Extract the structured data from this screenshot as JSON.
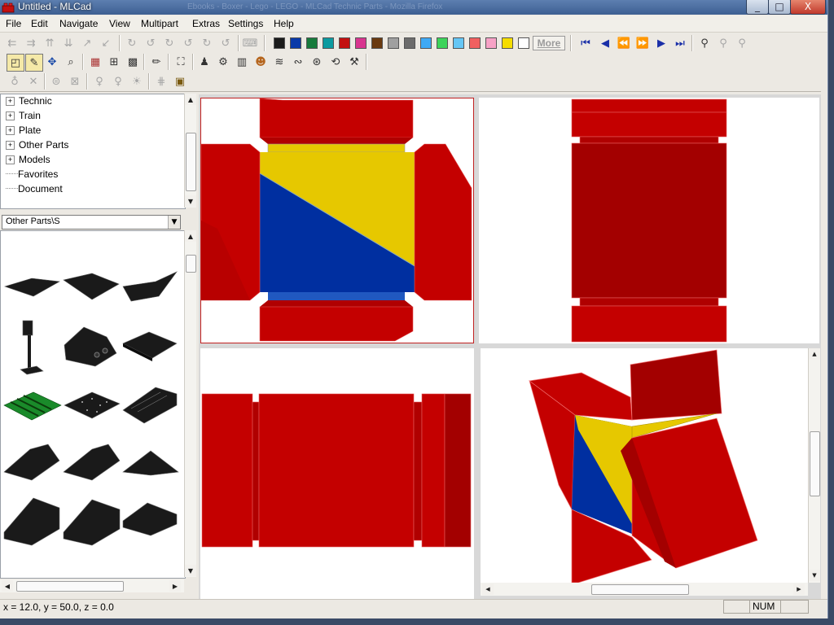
{
  "window": {
    "title": "Untitled - MLCad",
    "background_title": "Ebooks - Boxer - Lego - LEGO - MLCad Technic Parts - Mozilla Firefox",
    "buttons": {
      "minimize": "_",
      "maximize": "□",
      "close": "X"
    }
  },
  "menu": [
    "File",
    "Edit",
    "Navigate",
    "View",
    "Multipart",
    "Extras",
    "Settings",
    "Help"
  ],
  "toolbar_rows": [
    [
      {
        "name": "move-left-icon",
        "glyph": "⇇",
        "enabled": false
      },
      {
        "name": "move-right-icon",
        "glyph": "⇉",
        "enabled": false
      },
      {
        "name": "move-up-icon",
        "glyph": "⇈",
        "enabled": false
      },
      {
        "name": "move-down-icon",
        "glyph": "⇊",
        "enabled": false
      },
      {
        "name": "move-in-icon",
        "glyph": "↗",
        "enabled": false
      },
      {
        "name": "move-out-icon",
        "glyph": "↙",
        "enabled": false
      },
      {
        "name": "rotate-x-plus-icon",
        "glyph": "↻",
        "enabled": false
      },
      {
        "name": "rotate-x-minus-icon",
        "glyph": "↺",
        "enabled": false
      },
      {
        "name": "rotate-y-plus-icon",
        "glyph": "↻",
        "enabled": false
      },
      {
        "name": "rotate-y-minus-icon",
        "glyph": "↺",
        "enabled": false
      },
      {
        "name": "rotate-z-plus-icon",
        "glyph": "↻",
        "enabled": false
      },
      {
        "name": "rotate-z-minus-icon",
        "glyph": "↺",
        "enabled": false
      },
      {
        "name": "keyboard-icon",
        "glyph": "⌨",
        "enabled": false
      }
    ],
    [
      {
        "name": "select-icon",
        "glyph": "◰",
        "enabled": true
      },
      {
        "name": "edit-icon",
        "glyph": "✎",
        "enabled": true
      },
      {
        "name": "move-icon",
        "glyph": "✥",
        "enabled": true
      },
      {
        "name": "zoom-icon",
        "glyph": "⌕",
        "enabled": true
      },
      {
        "name": "view-layout-icon",
        "glyph": "▦",
        "enabled": true
      },
      {
        "name": "grid-icon",
        "glyph": "⊞",
        "enabled": true
      },
      {
        "name": "render-icon",
        "glyph": "▩",
        "enabled": true
      },
      {
        "name": "color-pencil-icon",
        "glyph": "✏",
        "enabled": true
      },
      {
        "name": "part-properties-icon",
        "glyph": "⛶",
        "enabled": true
      },
      {
        "name": "minifig-stand-icon",
        "glyph": "♟",
        "enabled": true
      },
      {
        "name": "gear-part-icon",
        "glyph": "⚙",
        "enabled": true
      },
      {
        "name": "minifig-head-icon",
        "glyph": "☻",
        "enabled": true
      },
      {
        "name": "spring-icon",
        "glyph": "≋",
        "enabled": true
      },
      {
        "name": "hose-icon",
        "glyph": "∾",
        "enabled": true
      },
      {
        "name": "wheel-icon",
        "glyph": "⊛",
        "enabled": true
      },
      {
        "name": "rotation-point-icon",
        "glyph": "⟲",
        "enabled": true
      },
      {
        "name": "crane-icon",
        "glyph": "⚒",
        "enabled": true
      }
    ],
    [
      {
        "name": "lamp-off-icon",
        "glyph": "♁",
        "enabled": false
      },
      {
        "name": "lamp-cross-icon",
        "glyph": "✕",
        "enabled": false
      },
      {
        "name": "group-icon",
        "glyph": "⊜",
        "enabled": false
      },
      {
        "name": "ungroup-icon",
        "glyph": "⊠",
        "enabled": false
      },
      {
        "name": "light-bulb-icon",
        "glyph": "♀",
        "enabled": false
      },
      {
        "name": "light-bulb-on-icon",
        "glyph": "♀",
        "enabled": false
      },
      {
        "name": "light-bulbs-icon",
        "glyph": "☀",
        "enabled": false
      },
      {
        "name": "grid-snap-icon",
        "glyph": "⋕",
        "enabled": false
      },
      {
        "name": "camera-icon",
        "glyph": "▣",
        "enabled": true
      }
    ]
  ],
  "palette": {
    "colors": [
      "#1b1b1b",
      "#0a3aa8",
      "#177a3c",
      "#0c9aa0",
      "#c31010",
      "#d8358f",
      "#6a3a10",
      "#a0a0a0",
      "#6c6c6c",
      "#3fa9f5",
      "#3dd35a",
      "#65c6f5",
      "#f16060",
      "#f7a2c6",
      "#f5dd00",
      "#ffffff"
    ],
    "more_label": "More"
  },
  "nav_buttons": [
    {
      "name": "first-step-icon",
      "glyph": "⏮"
    },
    {
      "name": "previous-step-icon",
      "glyph": "◀"
    },
    {
      "name": "rewind-icon",
      "glyph": "⏪"
    },
    {
      "name": "fast-forward-icon",
      "glyph": "⏩"
    },
    {
      "name": "next-step-icon",
      "glyph": "▶"
    },
    {
      "name": "last-step-icon",
      "glyph": "⏭"
    },
    {
      "name": "find-icon",
      "glyph": "⚲"
    },
    {
      "name": "filter-icon",
      "glyph": "⚲"
    },
    {
      "name": "filter-advanced-icon",
      "glyph": "⚲"
    }
  ],
  "tree": {
    "items": [
      {
        "label": "Technic",
        "expandable": true
      },
      {
        "label": "Train",
        "expandable": true
      },
      {
        "label": "Plate",
        "expandable": true
      },
      {
        "label": "Other Parts",
        "expandable": true
      },
      {
        "label": "Models",
        "expandable": true
      },
      {
        "label": "Favorites",
        "expandable": false
      },
      {
        "label": "Document",
        "expandable": false
      }
    ]
  },
  "category_select": {
    "value": "Other Parts\\S"
  },
  "parts_preview": {
    "rows": [
      [
        "flat-slope-wedge",
        "flat-slope-wedge",
        "flat-slope-wedge-studs"
      ],
      [
        "sign-post",
        "slope-brick-holes",
        "slope-plate"
      ],
      [
        "tile-striped-green",
        "tile-speckled",
        "slope-grille"
      ],
      [
        "slope-33",
        "slope-33",
        "slope-corner"
      ],
      [
        "slope-45-large",
        "slope-45-large",
        "slope-45-flat"
      ]
    ]
  },
  "status": {
    "coordinates": "x = 12.0, y = 50.0, z = 0.0",
    "num": "NUM"
  },
  "colors": {
    "brick_red": "#c40000",
    "dark_red": "#a30000",
    "yellow": "#e6c800",
    "blue": "#002fa0",
    "active_viewport_border": "#c02020"
  }
}
